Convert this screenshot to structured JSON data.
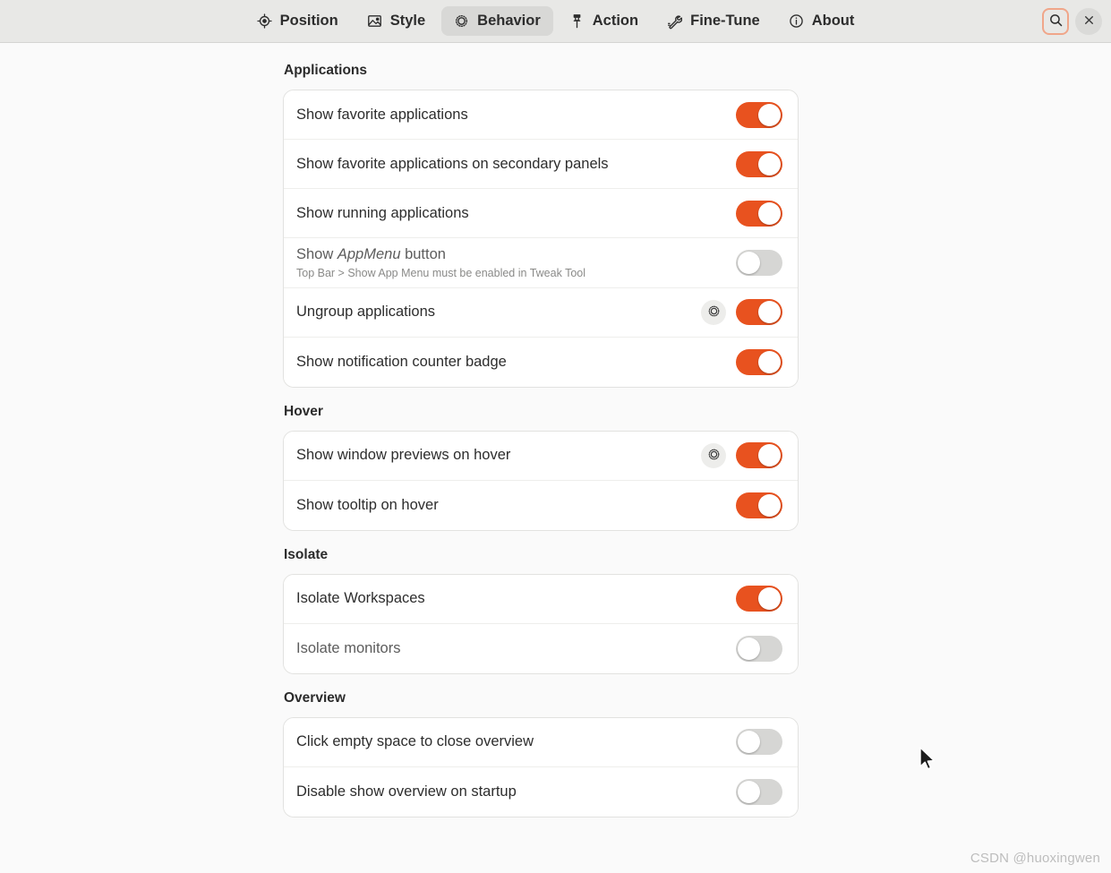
{
  "header": {
    "tabs": [
      {
        "label": "Position",
        "icon": "target-icon",
        "selected": false
      },
      {
        "label": "Style",
        "icon": "image-icon",
        "selected": false
      },
      {
        "label": "Behavior",
        "icon": "cog-icon",
        "selected": true
      },
      {
        "label": "Action",
        "icon": "pin-icon",
        "selected": false
      },
      {
        "label": "Fine-Tune",
        "icon": "wrench-icon",
        "selected": false
      },
      {
        "label": "About",
        "icon": "info-icon",
        "selected": false
      }
    ],
    "search_button": {
      "name": "search-icon",
      "focused": true
    },
    "close_button": {
      "name": "close-icon"
    }
  },
  "colors": {
    "accent": "#e8521f",
    "header_bg": "#e8e8e6",
    "page_bg": "#fafafa",
    "card_bg": "#ffffff",
    "focus_ring": "#f0a68a",
    "switch_off": "#d6d6d4"
  },
  "groups": [
    {
      "title": "Applications",
      "rows": [
        {
          "title": "Show favorite applications",
          "subtitle": "",
          "has_cog": false,
          "switch": "on",
          "dim": false
        },
        {
          "title": "Show favorite applications on secondary panels",
          "subtitle": "",
          "has_cog": false,
          "switch": "on",
          "dim": false
        },
        {
          "title": "Show running applications",
          "subtitle": "",
          "has_cog": false,
          "switch": "on",
          "dim": false
        },
        {
          "title": "Show AppMenu button",
          "title_pre": "Show ",
          "title_em": "AppMenu",
          "title_post": " button",
          "subtitle": "Top Bar > Show App Menu must be enabled in Tweak Tool",
          "has_cog": false,
          "switch": "off",
          "dim": true
        },
        {
          "title": "Ungroup applications",
          "subtitle": "",
          "has_cog": true,
          "switch": "on",
          "dim": false
        },
        {
          "title": "Show notification counter badge",
          "subtitle": "",
          "has_cog": false,
          "switch": "on",
          "dim": false
        }
      ]
    },
    {
      "title": "Hover",
      "rows": [
        {
          "title": "Show window previews on hover",
          "subtitle": "",
          "has_cog": true,
          "switch": "on",
          "dim": false
        },
        {
          "title": "Show tooltip on hover",
          "subtitle": "",
          "has_cog": false,
          "switch": "on",
          "dim": false
        }
      ]
    },
    {
      "title": "Isolate",
      "rows": [
        {
          "title": "Isolate Workspaces",
          "subtitle": "",
          "has_cog": false,
          "switch": "on",
          "dim": false
        },
        {
          "title": "Isolate monitors",
          "subtitle": "",
          "has_cog": false,
          "switch": "off",
          "dim": true
        }
      ]
    },
    {
      "title": "Overview",
      "rows": [
        {
          "title": "Click empty space to close overview",
          "subtitle": "",
          "has_cog": false,
          "switch": "off",
          "dim": false
        },
        {
          "title": "Disable show overview on startup",
          "subtitle": "",
          "has_cog": false,
          "switch": "off",
          "dim": false
        }
      ]
    }
  ],
  "watermark": "CSDN @huoxingwen"
}
